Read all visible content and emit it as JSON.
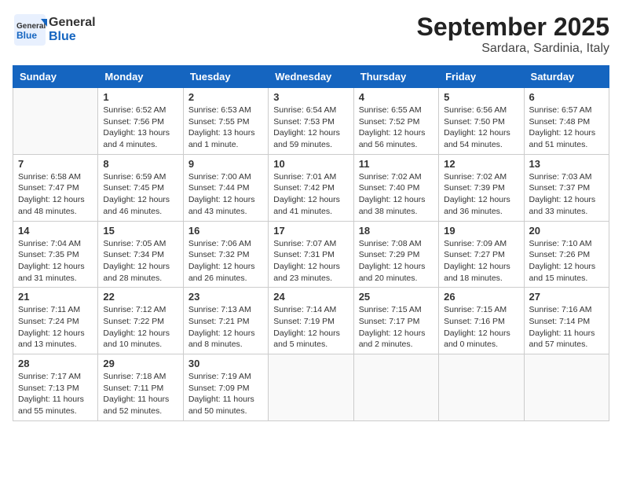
{
  "logo": {
    "text_general": "General",
    "text_blue": "Blue"
  },
  "header": {
    "month": "September 2025",
    "location": "Sardara, Sardinia, Italy"
  },
  "days_of_week": [
    "Sunday",
    "Monday",
    "Tuesday",
    "Wednesday",
    "Thursday",
    "Friday",
    "Saturday"
  ],
  "weeks": [
    [
      {
        "day": "",
        "info": ""
      },
      {
        "day": "1",
        "info": "Sunrise: 6:52 AM\nSunset: 7:56 PM\nDaylight: 13 hours\nand 4 minutes."
      },
      {
        "day": "2",
        "info": "Sunrise: 6:53 AM\nSunset: 7:55 PM\nDaylight: 13 hours\nand 1 minute."
      },
      {
        "day": "3",
        "info": "Sunrise: 6:54 AM\nSunset: 7:53 PM\nDaylight: 12 hours\nand 59 minutes."
      },
      {
        "day": "4",
        "info": "Sunrise: 6:55 AM\nSunset: 7:52 PM\nDaylight: 12 hours\nand 56 minutes."
      },
      {
        "day": "5",
        "info": "Sunrise: 6:56 AM\nSunset: 7:50 PM\nDaylight: 12 hours\nand 54 minutes."
      },
      {
        "day": "6",
        "info": "Sunrise: 6:57 AM\nSunset: 7:48 PM\nDaylight: 12 hours\nand 51 minutes."
      }
    ],
    [
      {
        "day": "7",
        "info": "Sunrise: 6:58 AM\nSunset: 7:47 PM\nDaylight: 12 hours\nand 48 minutes."
      },
      {
        "day": "8",
        "info": "Sunrise: 6:59 AM\nSunset: 7:45 PM\nDaylight: 12 hours\nand 46 minutes."
      },
      {
        "day": "9",
        "info": "Sunrise: 7:00 AM\nSunset: 7:44 PM\nDaylight: 12 hours\nand 43 minutes."
      },
      {
        "day": "10",
        "info": "Sunrise: 7:01 AM\nSunset: 7:42 PM\nDaylight: 12 hours\nand 41 minutes."
      },
      {
        "day": "11",
        "info": "Sunrise: 7:02 AM\nSunset: 7:40 PM\nDaylight: 12 hours\nand 38 minutes."
      },
      {
        "day": "12",
        "info": "Sunrise: 7:02 AM\nSunset: 7:39 PM\nDaylight: 12 hours\nand 36 minutes."
      },
      {
        "day": "13",
        "info": "Sunrise: 7:03 AM\nSunset: 7:37 PM\nDaylight: 12 hours\nand 33 minutes."
      }
    ],
    [
      {
        "day": "14",
        "info": "Sunrise: 7:04 AM\nSunset: 7:35 PM\nDaylight: 12 hours\nand 31 minutes."
      },
      {
        "day": "15",
        "info": "Sunrise: 7:05 AM\nSunset: 7:34 PM\nDaylight: 12 hours\nand 28 minutes."
      },
      {
        "day": "16",
        "info": "Sunrise: 7:06 AM\nSunset: 7:32 PM\nDaylight: 12 hours\nand 26 minutes."
      },
      {
        "day": "17",
        "info": "Sunrise: 7:07 AM\nSunset: 7:31 PM\nDaylight: 12 hours\nand 23 minutes."
      },
      {
        "day": "18",
        "info": "Sunrise: 7:08 AM\nSunset: 7:29 PM\nDaylight: 12 hours\nand 20 minutes."
      },
      {
        "day": "19",
        "info": "Sunrise: 7:09 AM\nSunset: 7:27 PM\nDaylight: 12 hours\nand 18 minutes."
      },
      {
        "day": "20",
        "info": "Sunrise: 7:10 AM\nSunset: 7:26 PM\nDaylight: 12 hours\nand 15 minutes."
      }
    ],
    [
      {
        "day": "21",
        "info": "Sunrise: 7:11 AM\nSunset: 7:24 PM\nDaylight: 12 hours\nand 13 minutes."
      },
      {
        "day": "22",
        "info": "Sunrise: 7:12 AM\nSunset: 7:22 PM\nDaylight: 12 hours\nand 10 minutes."
      },
      {
        "day": "23",
        "info": "Sunrise: 7:13 AM\nSunset: 7:21 PM\nDaylight: 12 hours\nand 8 minutes."
      },
      {
        "day": "24",
        "info": "Sunrise: 7:14 AM\nSunset: 7:19 PM\nDaylight: 12 hours\nand 5 minutes."
      },
      {
        "day": "25",
        "info": "Sunrise: 7:15 AM\nSunset: 7:17 PM\nDaylight: 12 hours\nand 2 minutes."
      },
      {
        "day": "26",
        "info": "Sunrise: 7:15 AM\nSunset: 7:16 PM\nDaylight: 12 hours\nand 0 minutes."
      },
      {
        "day": "27",
        "info": "Sunrise: 7:16 AM\nSunset: 7:14 PM\nDaylight: 11 hours\nand 57 minutes."
      }
    ],
    [
      {
        "day": "28",
        "info": "Sunrise: 7:17 AM\nSunset: 7:13 PM\nDaylight: 11 hours\nand 55 minutes."
      },
      {
        "day": "29",
        "info": "Sunrise: 7:18 AM\nSunset: 7:11 PM\nDaylight: 11 hours\nand 52 minutes."
      },
      {
        "day": "30",
        "info": "Sunrise: 7:19 AM\nSunset: 7:09 PM\nDaylight: 11 hours\nand 50 minutes."
      },
      {
        "day": "",
        "info": ""
      },
      {
        "day": "",
        "info": ""
      },
      {
        "day": "",
        "info": ""
      },
      {
        "day": "",
        "info": ""
      }
    ]
  ]
}
